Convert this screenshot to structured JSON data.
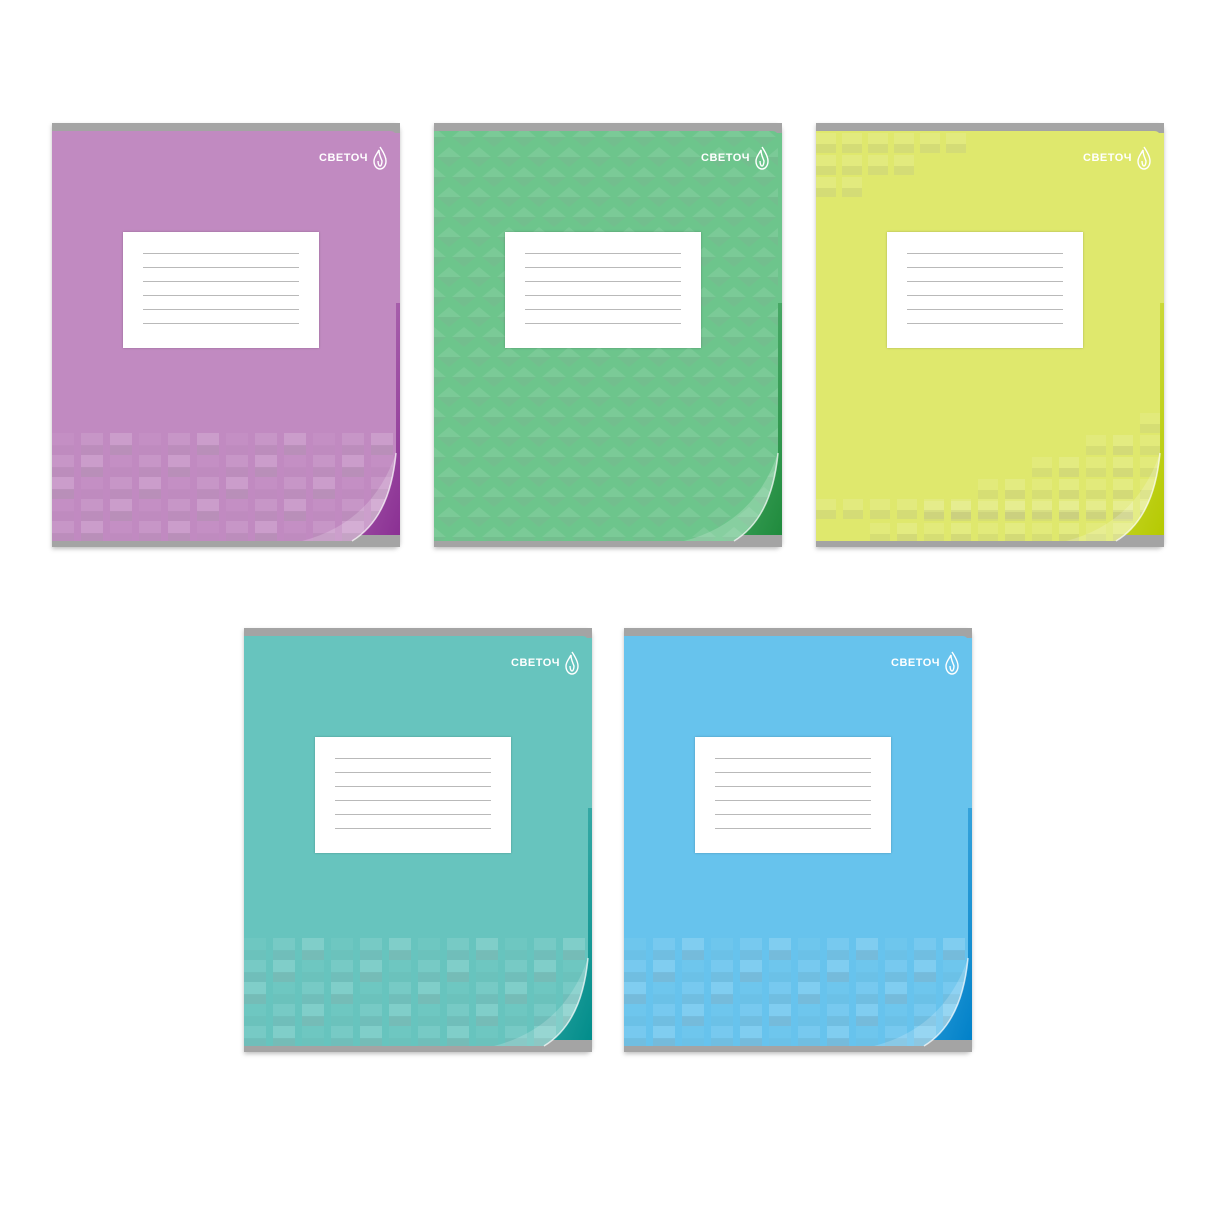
{
  "notebooks": [
    {
      "brand": "СВЕТОЧ",
      "color": "#c18ac1",
      "dark": "#8a2f93",
      "edge": "#a4a4a4",
      "pattern": "bottom"
    },
    {
      "brand": "СВЕТОЧ",
      "color": "#6dc58c",
      "dark": "#1f8a3c",
      "edge": "#a4a4a4",
      "pattern": "full"
    },
    {
      "brand": "СВЕТОЧ",
      "color": "#dfe86d",
      "dark": "#b5c900",
      "edge": "#a4a4a4",
      "pattern": "corners"
    },
    {
      "brand": "СВЕТОЧ",
      "color": "#67c4be",
      "dark": "#008c8a",
      "edge": "#a4a4a4",
      "pattern": "bottom"
    },
    {
      "brand": "СВЕТОЧ",
      "color": "#67c3ed",
      "dark": "#0080c8",
      "edge": "#a4a4a4",
      "pattern": "bottom"
    }
  ]
}
